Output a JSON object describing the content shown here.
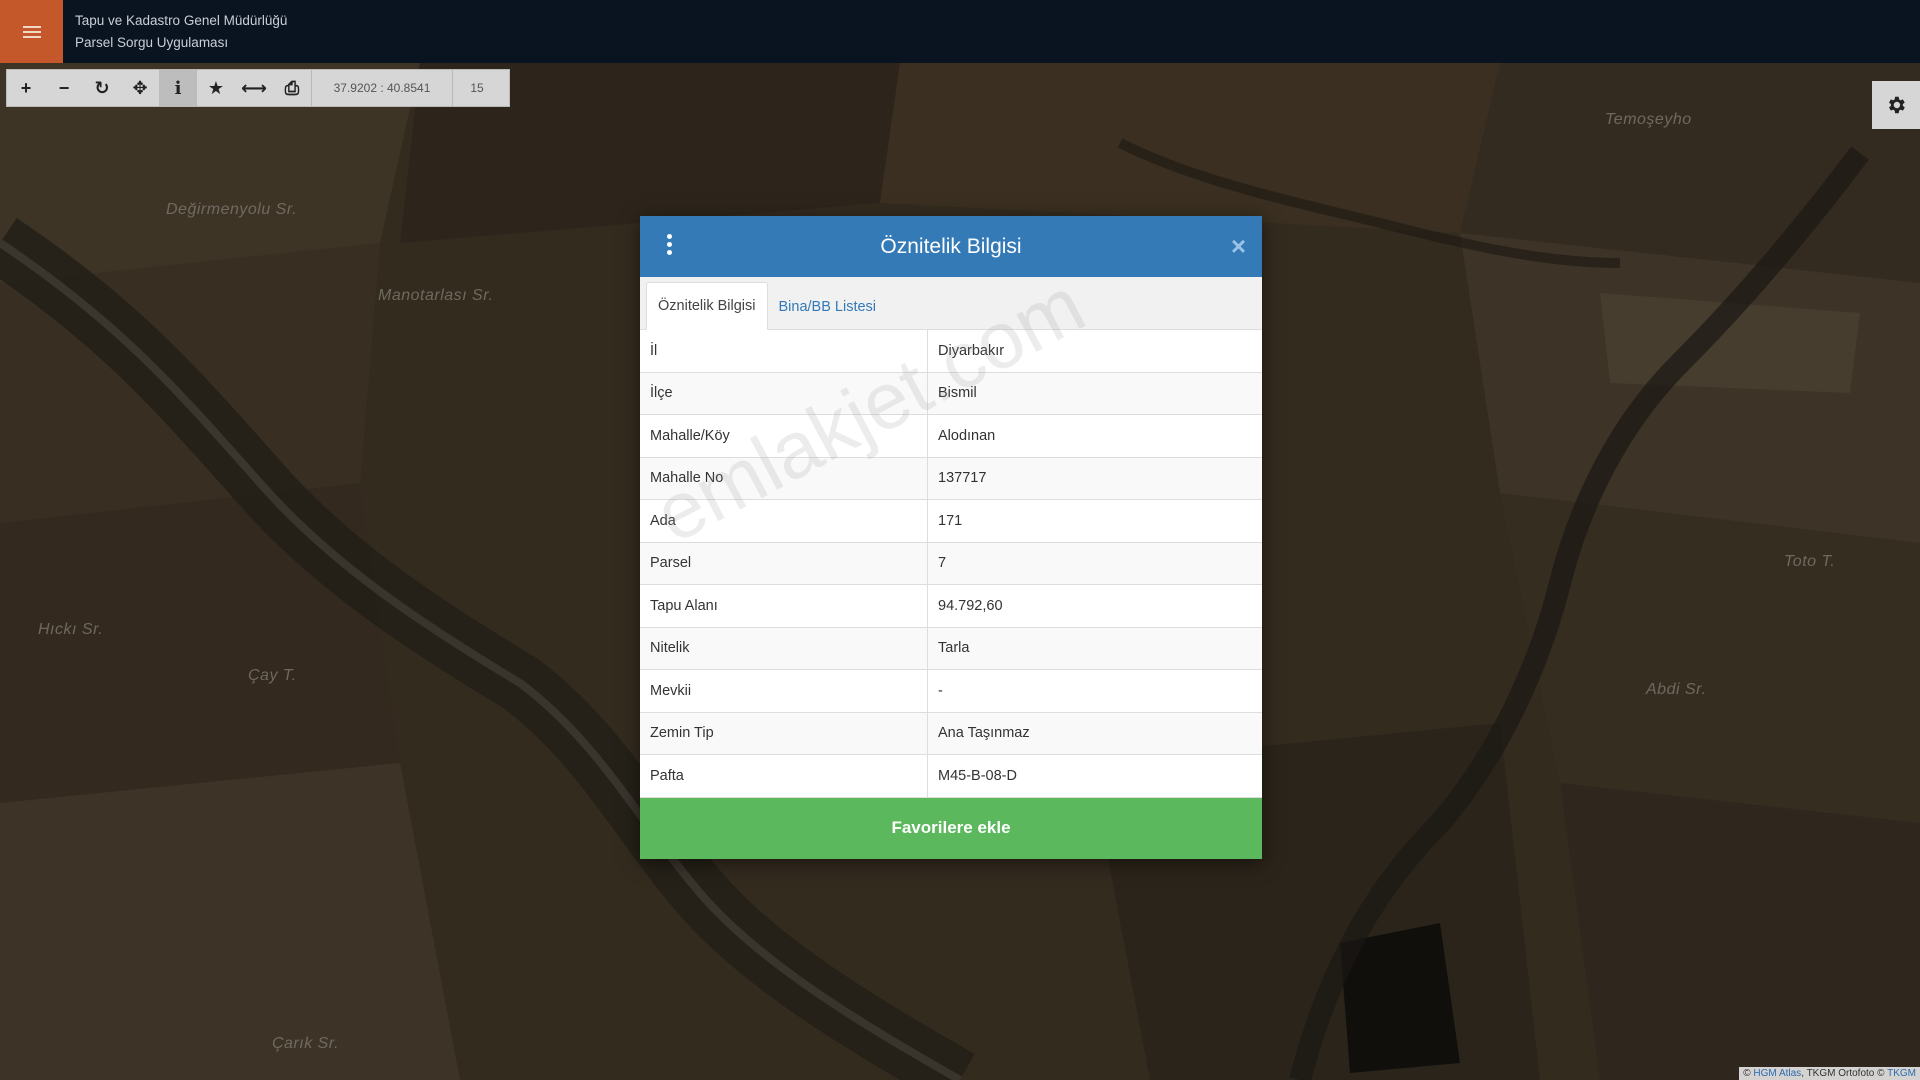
{
  "header": {
    "title_line1": "Tapu ve Kadastro Genel Müdürlüğü",
    "title_line2": "Parsel Sorgu Uygulaması",
    "menu_icon": "hamburger-icon"
  },
  "toolbar": {
    "tools": [
      {
        "name": "zoom-in-icon",
        "glyph": "+"
      },
      {
        "name": "zoom-out-icon",
        "glyph": "−"
      },
      {
        "name": "refresh-icon",
        "glyph": "↻"
      },
      {
        "name": "locate-icon",
        "glyph": "✥"
      },
      {
        "name": "info-icon",
        "glyph": "i"
      },
      {
        "name": "star-icon",
        "glyph": "★"
      },
      {
        "name": "measure-icon",
        "glyph": "⟷"
      },
      {
        "name": "print-icon",
        "glyph": "⎙"
      }
    ],
    "coordinates": "37.9202 : 40.8541",
    "zoom_level": "15"
  },
  "map": {
    "place_names": [
      "Temoşeyho",
      "Değirmenyolu Sr.",
      "Manotarlası Sr.",
      "Hıckı Sr.",
      "Çay T.",
      "Toto T.",
      "Abdi Sr.",
      "Çarık Sr."
    ],
    "settings_icon": "gear-icon"
  },
  "modal": {
    "title": "Öznitelik Bilgisi",
    "tabs": [
      "Öznitelik Bilgisi",
      "Bina/BB Listesi"
    ],
    "rows": [
      {
        "label": "İl",
        "value": "Diyarbakır"
      },
      {
        "label": "İlçe",
        "value": "Bismil"
      },
      {
        "label": "Mahalle/Köy",
        "value": "Alodınan"
      },
      {
        "label": "Mahalle No",
        "value": "137717"
      },
      {
        "label": "Ada",
        "value": "171"
      },
      {
        "label": "Parsel",
        "value": "7"
      },
      {
        "label": "Tapu Alanı",
        "value": "94.792,60"
      },
      {
        "label": "Nitelik",
        "value": "Tarla"
      },
      {
        "label": "Mevkii",
        "value": "-"
      },
      {
        "label": "Zemin Tip",
        "value": "Ana Taşınmaz"
      },
      {
        "label": "Pafta",
        "value": "M45-B-08-D"
      }
    ],
    "favorite_button": "Favorilere ekle",
    "close_symbol": "×"
  },
  "watermark": "emlakjet.com",
  "attribution": {
    "prefix": "© ",
    "link1": "HGM Atlas",
    "middle": ", TKGM Ortofoto © ",
    "link2": "TKGM"
  },
  "colors": {
    "header_bg": "#0a1420",
    "menu_bg": "#c4582a",
    "modal_header": "#337ab7",
    "favorite_button": "#5cb85c"
  }
}
